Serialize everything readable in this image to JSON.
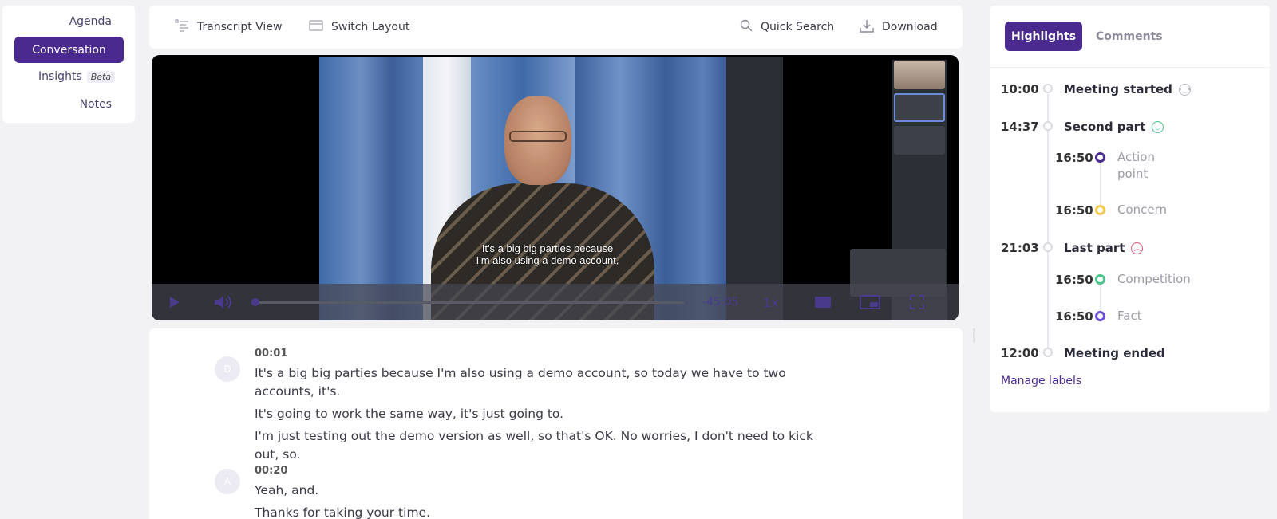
{
  "nav": {
    "agenda": "Agenda",
    "conversation": "Conversation",
    "insights": "Insights",
    "beta": "Beta",
    "notes": "Notes"
  },
  "toolbar": {
    "transcript_view": "Transcript View",
    "switch_layout": "Switch Layout",
    "quick_search": "Quick Search",
    "download": "Download"
  },
  "video": {
    "subtitle_line1": "It's a big big parties because",
    "subtitle_line2": "I'm also using a demo account,",
    "time_remaining": "-45:05",
    "speed": "1x"
  },
  "transcript": {
    "entries": [
      {
        "avatar": "D",
        "time": "00:01",
        "lines": [
          "It's a big big parties because I'm also using a demo account, so today we have to two accounts, it's.",
          "It's going to work the same way, it's just going to.",
          "I'm just testing out the demo version as well, so that's OK. No worries, I don't need to kick out, so."
        ]
      },
      {
        "avatar": "A",
        "time": "00:20",
        "lines": [
          "Yeah, and.",
          "Thanks for taking your time."
        ]
      }
    ]
  },
  "panel": {
    "tab_highlights": "Highlights",
    "tab_comments": "Comments",
    "events": [
      {
        "time": "10:00",
        "label": "Meeting started",
        "emoji": "neutral"
      },
      {
        "time": "14:37",
        "label": "Second part",
        "emoji": "happy"
      },
      {
        "time": "21:03",
        "label": "Last part",
        "emoji": "sad"
      },
      {
        "time": "12:00",
        "label": "Meeting ended",
        "emoji": ""
      }
    ],
    "sub_events": [
      {
        "time": "16:50",
        "label_line1": "Action",
        "label_line2": "point",
        "color": "#4b2a8f"
      },
      {
        "time": "16:50",
        "label": "Concern",
        "color": "#f2c94c"
      },
      {
        "time": "16:50",
        "label": "Competition",
        "color": "#4cc38a"
      },
      {
        "time": "16:50",
        "label": "Fact",
        "color": "#6b4fd6"
      }
    ],
    "manage_labels": "Manage labels"
  },
  "colors": {
    "accent": "#4b2a8f",
    "neutral_emoji": "#b5b5c0",
    "happy_emoji": "#4cc38a",
    "sad_emoji": "#e05a7a"
  }
}
